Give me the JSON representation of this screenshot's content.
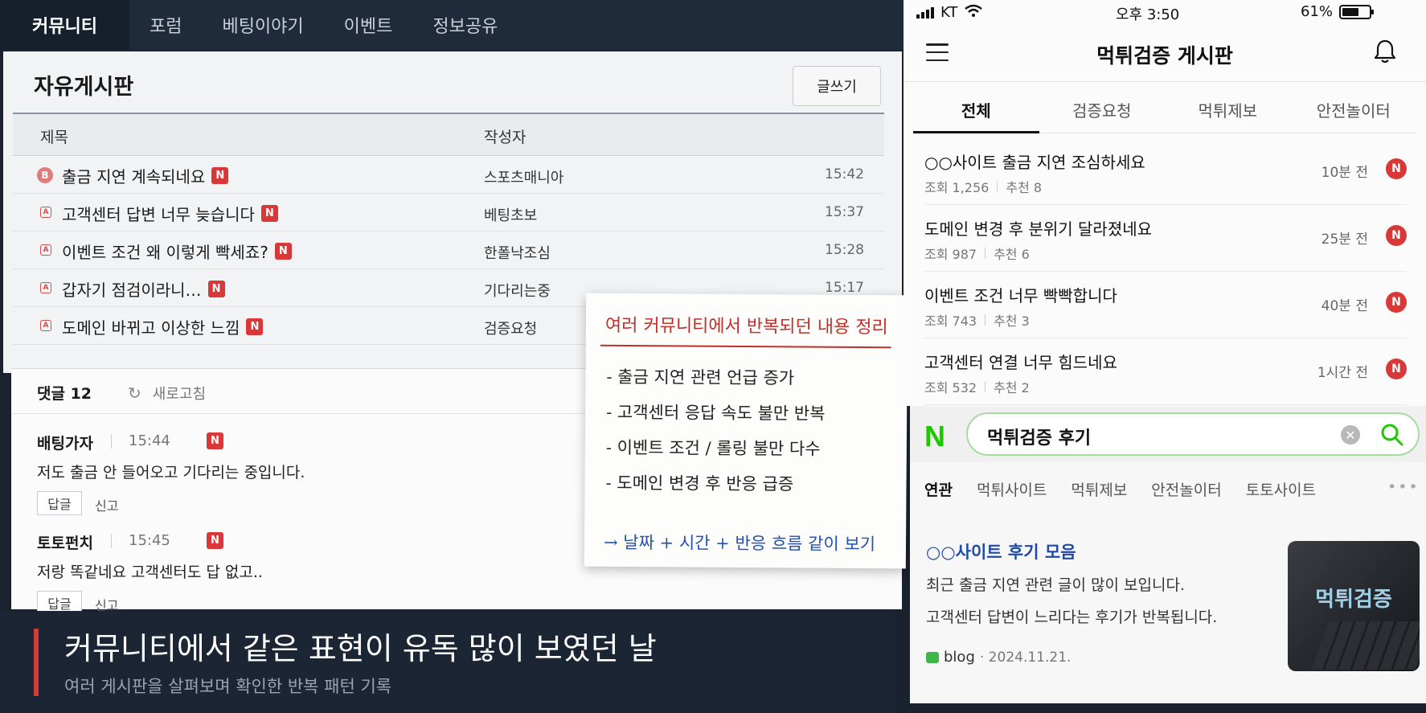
{
  "topnav": {
    "items": [
      {
        "label": "커뮤니티",
        "active": true
      },
      {
        "label": "포럼"
      },
      {
        "label": "베팅이야기"
      },
      {
        "label": "이벤트"
      },
      {
        "label": "정보공유"
      }
    ]
  },
  "board": {
    "title": "자유게시판",
    "write_label": "글쓰기",
    "col_title": "제목",
    "col_author": "작성자",
    "new_badge": "N",
    "best_badge": "B",
    "a_badge": "A",
    "posts": [
      {
        "title": "출금 지연 계속되네요",
        "author": "스포츠매니아",
        "time": "15:42"
      },
      {
        "title": "고객센터 답변 너무 늦습니다",
        "author": "베팅초보",
        "time": "15:37"
      },
      {
        "title": "이벤트 조건 왜 이렇게 빡세죠?",
        "author": "한폴낙조심",
        "time": "15:28"
      },
      {
        "title": "갑자기 점검이라니…",
        "author": "기다리는중",
        "time": "15:17"
      },
      {
        "title": "도메인 바뀌고 이상한 느낌",
        "author": "검증요청",
        "time": ""
      }
    ]
  },
  "comments": {
    "count_label": "댓글 12",
    "refresh_label": "새로고침",
    "reply_label": "답글",
    "report_label": "신고",
    "items": [
      {
        "author": "배팅가자",
        "time": "15:44",
        "text": "저도 출금 안 들어오고 기다리는 중입니다."
      },
      {
        "author": "토토펀치",
        "time": "15:45",
        "text": "저랑 똑같네요 고객센터도 답 없고.."
      }
    ]
  },
  "note": {
    "title": "여러 커뮤니티에서 반복되던 내용 정리",
    "items": [
      "- 출금 지연 관련 언급 증가",
      "- 고객센터 응답 속도 불만 반복",
      "- 이벤트 조건 / 롤링 불만 다수",
      "- 도메인 변경 후 반응 급증"
    ],
    "conclusion": "→ 날짜 + 시간 + 반응 흐름 같이 보기"
  },
  "caption": {
    "main": "커뮤니티에서 같은 표현이 유독 많이 보였던 날",
    "sub": "여러 게시판을 살펴보며 확인한 반복 패턴 기록"
  },
  "phone": {
    "status": {
      "carrier": "KT",
      "time": "오후 3:50",
      "battery": "61%",
      "battery_level": 0.61
    },
    "title": "먹튀검증 게시판",
    "tabs": [
      "전체",
      "검증요청",
      "먹튀제보",
      "안전놀이터"
    ],
    "active_tab": 0,
    "posts": [
      {
        "title": "○○사이트 출금 지연 조심하세요",
        "views": "조회 1,256",
        "likes": "추천 8",
        "time": "10분 전"
      },
      {
        "title": "도메인 변경 후 분위기 달라졌네요",
        "views": "조회 987",
        "likes": "추천 6",
        "time": "25분 전"
      },
      {
        "title": "이벤트 조건 너무 빡빡합니다",
        "views": "조회 743",
        "likes": "추천 3",
        "time": "40분 전"
      },
      {
        "title": "고객센터 연결 너무 힘드네요",
        "views": "조회 532",
        "likes": "추천 2",
        "time": "1시간 전"
      }
    ],
    "new_badge": "N"
  },
  "search": {
    "logo": "N",
    "query": "먹튀검증 후기",
    "tabs": [
      "연관",
      "먹튀사이트",
      "먹튀제보",
      "안전놀이터",
      "토토사이트"
    ],
    "more": "•••",
    "result_title": "○○사이트 후기 모음",
    "result_lines": [
      "최근 출금 지연 관련 글이 많이 보입니다.",
      "고객센터 답변이 느리다는 후기가 반복됩니다."
    ],
    "source": "blog",
    "date": "· 2024.11.21.",
    "thumb_text": "먹튀검증"
  },
  "colors": {
    "nav_bg": "#1f2a3a",
    "accent_red": "#d93838",
    "naver_green": "#1ec800",
    "link_blue": "#1f4aa8"
  }
}
